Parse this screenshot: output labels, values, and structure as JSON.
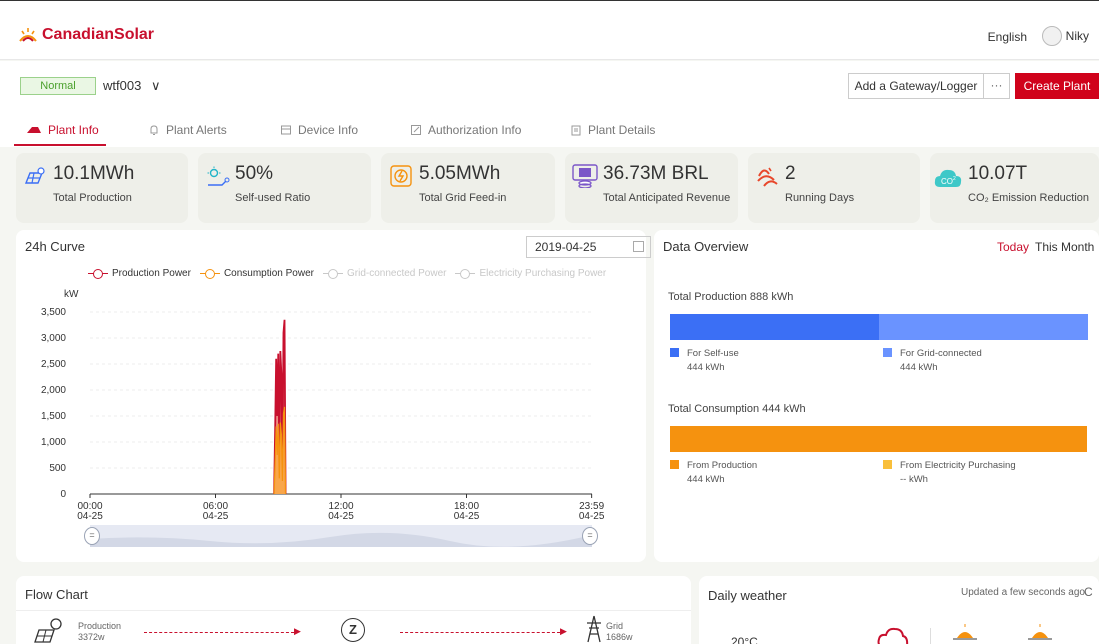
{
  "header": {
    "brand": "CanadianSolar",
    "language": "English",
    "user": "Niky"
  },
  "plant": {
    "status": "Normal",
    "name": "wtf003",
    "add_gateway_label": "Add a Gateway/Logger",
    "more_label": "···",
    "create_label": "Create Plant"
  },
  "tabs": [
    {
      "label": "Plant Info",
      "icon": "plant-info-icon"
    },
    {
      "label": "Plant Alerts",
      "icon": "bell-icon"
    },
    {
      "label": "Device Info",
      "icon": "device-icon"
    },
    {
      "label": "Authorization Info",
      "icon": "edit-icon"
    },
    {
      "label": "Plant Details",
      "icon": "clipboard-icon"
    }
  ],
  "kpis": [
    {
      "value": "10.1MWh",
      "label": "Total Production",
      "icon": "solar-panel-icon"
    },
    {
      "value": "50%",
      "label": "Self-used Ratio",
      "icon": "self-use-icon"
    },
    {
      "value": "5.05MWh",
      "label": "Total Grid Feed-in",
      "icon": "grid-feed-icon"
    },
    {
      "value": "36.73M BRL",
      "label": "Total Anticipated Revenue",
      "icon": "revenue-icon"
    },
    {
      "value": "2",
      "label": "Running Days",
      "icon": "running-days-icon"
    },
    {
      "value": "10.07T",
      "label": "CO₂ Emission Reduction",
      "icon": "co2-icon"
    }
  ],
  "curve": {
    "title": "24h Curve",
    "date": "2019-04-25"
  },
  "overview": {
    "title": "Data Overview",
    "today": "Today",
    "this_month": "This Month",
    "production_total": "Total Production 888 kWh",
    "consumption_total": "Total Consumption 444 kWh",
    "production_split": [
      {
        "label": "For Self-use",
        "value": "444 kWh",
        "color": "#3b6ff5",
        "fraction": 0.5
      },
      {
        "label": "For Grid-connected",
        "value": "444 kWh",
        "color": "#6a93ff",
        "fraction": 0.5
      }
    ],
    "consumption_split": [
      {
        "label": "From Production",
        "value": "444 kWh",
        "color": "#f5920f",
        "fraction": 1.0
      },
      {
        "label": "From Electricity Purchasing",
        "value": "-- kWh",
        "color": "#f9bf3b",
        "fraction": 0.0
      }
    ]
  },
  "flow": {
    "title": "Flow Chart",
    "production_label": "Production",
    "production_value": "3372w",
    "grid_label": "Grid",
    "grid_value": "1686w"
  },
  "weather": {
    "title": "Daily weather",
    "updated": "Updated a few seconds ago",
    "temperature": "20°C"
  },
  "chart_data": {
    "type": "line",
    "title": "",
    "ylabel": "kW",
    "ylim": [
      0,
      3500
    ],
    "yticks": [
      "3,500",
      "3,000",
      "2,500",
      "2,000",
      "1,500",
      "1,000",
      "500",
      "0"
    ],
    "xticks": [
      {
        "time": "00:00",
        "date": "04-25"
      },
      {
        "time": "06:00",
        "date": "04-25"
      },
      {
        "time": "12:00",
        "date": "04-25"
      },
      {
        "time": "18:00",
        "date": "04-25"
      },
      {
        "time": "23:59",
        "date": "04-25"
      }
    ],
    "legend": [
      {
        "name": "Production Power",
        "color": "#c8102e",
        "active": true
      },
      {
        "name": "Consumption Power",
        "color": "#f5920f",
        "active": true
      },
      {
        "name": "Grid-connected Power",
        "color": "#c8c8c8",
        "active": false
      },
      {
        "name": "Electricity Purchasing Power",
        "color": "#c8c8c8",
        "active": false
      }
    ],
    "series": [
      {
        "name": "Production Power",
        "color": "#c8102e",
        "points": [
          [
            8.8,
            0
          ],
          [
            8.85,
            1200
          ],
          [
            8.9,
            2600
          ],
          [
            8.95,
            1500
          ],
          [
            9.0,
            2700
          ],
          [
            9.05,
            600
          ],
          [
            9.1,
            2750
          ],
          [
            9.15,
            2300
          ],
          [
            9.2,
            500
          ],
          [
            9.25,
            3100
          ],
          [
            9.3,
            3350
          ],
          [
            9.35,
            0
          ]
        ]
      },
      {
        "name": "Consumption Power",
        "color": "#f5920f",
        "points": [
          [
            8.8,
            0
          ],
          [
            8.85,
            600
          ],
          [
            8.9,
            1300
          ],
          [
            8.95,
            750
          ],
          [
            9.0,
            1350
          ],
          [
            9.05,
            300
          ],
          [
            9.1,
            1375
          ],
          [
            9.15,
            1150
          ],
          [
            9.2,
            250
          ],
          [
            9.25,
            1550
          ],
          [
            9.3,
            1675
          ],
          [
            9.35,
            0
          ]
        ]
      }
    ]
  }
}
